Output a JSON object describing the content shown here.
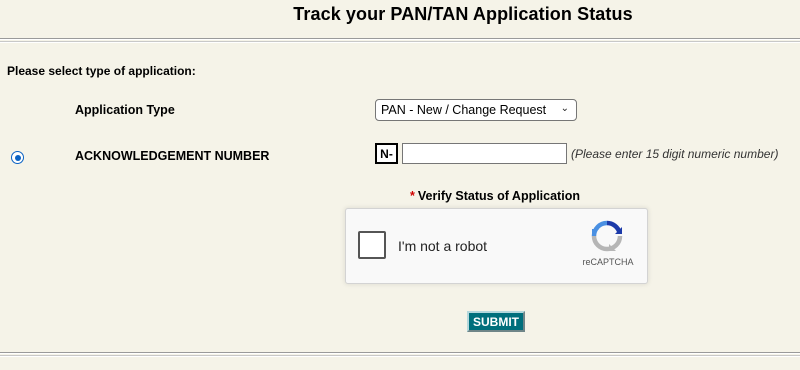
{
  "page": {
    "title": "Track your PAN/TAN Application Status",
    "select_prompt": "Please select type of application:"
  },
  "application_type": {
    "label": "Application Type",
    "selected": "PAN - New / Change Request"
  },
  "acknowledgement": {
    "label": "ACKNOWLEDGEMENT NUMBER",
    "prefix": "N-",
    "value": "",
    "hint": "(Please enter 15 digit numeric number)",
    "radio_selected": true
  },
  "verify": {
    "required_mark": "*",
    "label": "Verify Status of Application"
  },
  "captcha": {
    "checkbox_text": "I'm not a robot",
    "brand": "reCAPTCHA",
    "checked": false
  },
  "actions": {
    "submit_label": "SUBMIT"
  },
  "colors": {
    "background": "#f5f3e8",
    "submit_bg": "#006f7c",
    "radio_accent": "#0b62c4",
    "required_star": "#d00000"
  }
}
